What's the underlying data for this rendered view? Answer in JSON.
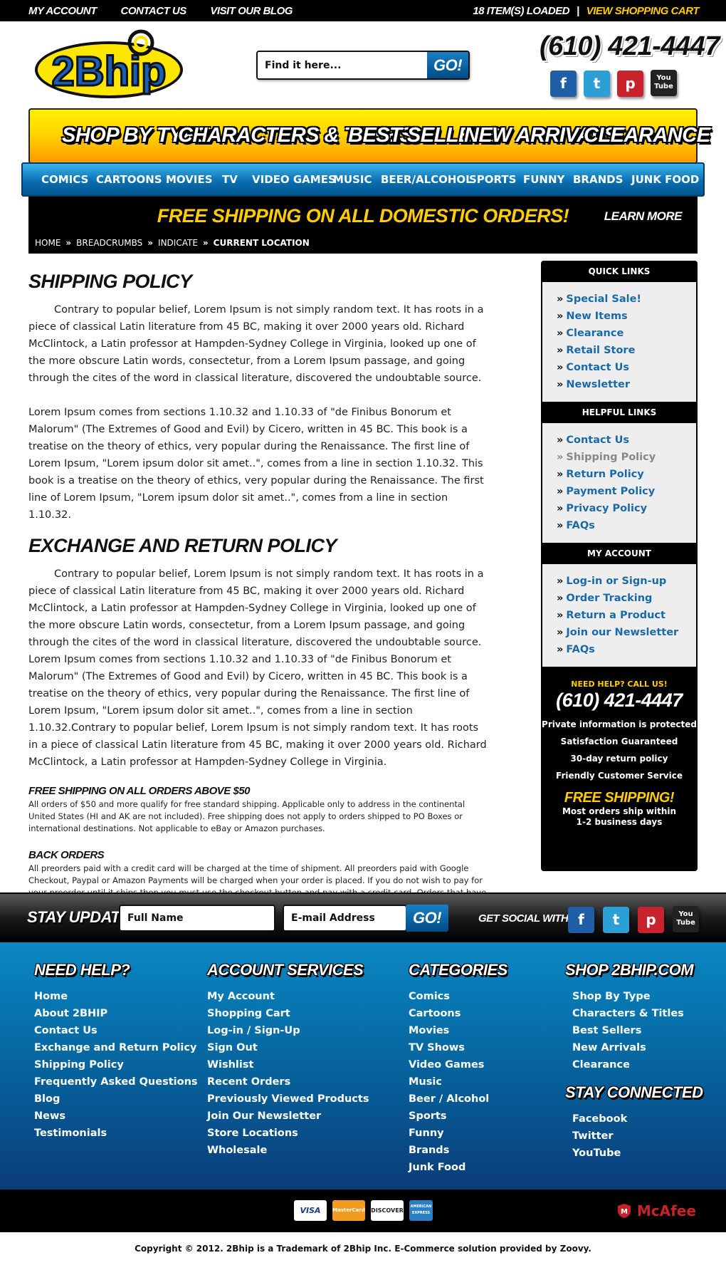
{
  "topbar": {
    "links": [
      "MY ACCOUNT",
      "CONTACT US",
      "VISIT OUR BLOG"
    ],
    "items_loaded": "18 ITEM(S) LOADED",
    "separator": "|",
    "view_cart": "VIEW SHOPPING CART"
  },
  "header": {
    "logo_text": "2Bhip",
    "search_placeholder": "Find it here...",
    "search_button": "GO!",
    "phone": "(610) 421-4447",
    "social": [
      "f",
      "t",
      "p",
      "You Tube"
    ]
  },
  "yellow_nav": [
    "SHOP BY TYPE",
    "CHARACTERS & TITLES",
    "BEST SELLERS",
    "NEW ARRIVALS",
    "CLEARANCE"
  ],
  "blue_nav": [
    "COMICS",
    "CARTOONS",
    "MOVIES",
    "TV",
    "VIDEO GAMES",
    "MUSIC",
    "BEER/ALCOHOL",
    "SPORTS",
    "FUNNY",
    "BRANDS",
    "JUNK FOOD"
  ],
  "banner": {
    "message": "FREE SHIPPING ON ALL DOMESTIC ORDERS!",
    "learn_more": "LEARN MORE"
  },
  "breadcrumb": {
    "items": [
      "HOME",
      "BREADCRUMBS",
      "INDICATE"
    ],
    "current": "CURRENT LOCATION",
    "separator": "»"
  },
  "main": {
    "h1": "SHIPPING POLICY",
    "p1": "Contrary to popular belief, Lorem Ipsum is not simply random text. It has roots in a piece of classical Latin literature from 45 BC, making it over 2000 years old. Richard McClintock, a Latin professor at Hampden-Sydney College in Virginia, looked up one of the more obscure Latin words, consectetur, from a Lorem Ipsum passage, and going through the cites of the word in classical literature, discovered the undoubtable source.",
    "p2": "Lorem Ipsum comes from sections 1.10.32 and 1.10.33 of \"de Finibus Bonorum et Malorum\" (The Extremes of Good and Evil) by Cicero, written in 45 BC. This book is a treatise on the theory of ethics, very popular during the Renaissance. The first line of Lorem Ipsum, \"Lorem ipsum dolor sit amet..\", comes from a line in section 1.10.32. This book is a treatise on the theory of ethics, very popular during the Renaissance. The first line of Lorem Ipsum, \"Lorem ipsum dolor sit amet..\", comes from a line in section 1.10.32.",
    "h2": "EXCHANGE AND RETURN POLICY",
    "p3": "Contrary to popular belief, Lorem Ipsum is not simply random text. It has roots in a piece of classical Latin literature from 45 BC, making it over 2000 years old. Richard McClintock, a Latin professor at Hampden-Sydney College in Virginia, looked up one of the more obscure Latin words, consectetur, from a Lorem Ipsum passage, and going through the cites of the word in classical literature, discovered the undoubtable source. Lorem Ipsum comes from sections 1.10.32 and 1.10.33 of \"de Finibus Bonorum et Malorum\" (The Extremes of Good and Evil) by Cicero, written in 45 BC. This book is a treatise on the theory of ethics, very popular during the Renaissance. The first line of Lorem Ipsum, \"Lorem ipsum dolor sit amet..\", comes from a line in section 1.10.32.Contrary to popular belief, Lorem Ipsum is not simply random text. It has roots in a piece of classical Latin literature from 45 BC, making it over 2000 years old. Richard McClintock, a Latin professor at Hampden-Sydney College in Virginia.",
    "h3": "FREE SHIPPING ON ALL ORDERS ABOVE $50",
    "p4": "All orders of $50 and more qualify for free standard shipping. Applicable only to address in the continental United States (HI and AK are not included). Free shipping does not apply to orders shipped to PO Boxes or international destinations. Not applicable to eBay or Amazon purchases.",
    "h4": "BACK ORDERS",
    "p5": "All preorders paid with a credit card will be charged at the time of shipment. All preorders paid with Google Checkout, Paypal or Amazon Payments will be charged when your order is placed. If you do not wish to pay for your preorder until it ships then you must use the checkout button and pay with a credit card. Orders that have both preorder and instock items we be shipped at the same time in one shipment."
  },
  "sidebar": {
    "quick_title": "QUICK LINKS",
    "quick": [
      "Special Sale!",
      "New Items",
      "Clearance",
      "Retail Store",
      "Contact Us",
      "Newsletter"
    ],
    "helpful_title": "HELPFUL LINKS",
    "helpful": [
      "Contact Us",
      "Shipping Policy",
      "Return Policy",
      "Payment Policy",
      "Privacy Policy",
      "FAQs"
    ],
    "account_title": "MY ACCOUNT",
    "account": [
      "Log-in or Sign-up",
      "Order Tracking",
      "Return a Product",
      "Join our Newsletter",
      "FAQs"
    ],
    "bullet": "»",
    "help": {
      "need": "NEED HELP? CALL US!",
      "phone": "(610) 421-4447",
      "lines": [
        "Private information is protected",
        "Satisfaction Guaranteed",
        "30-day return policy",
        "Friendly Customer Service"
      ],
      "free": "FREE SHIPPING!",
      "ships1": "Most orders ship within",
      "ships2": "1-2 business days"
    }
  },
  "stay": {
    "label": "STAY UPDATED!",
    "name_placeholder": "Full Name",
    "email_placeholder": "E-mail Address",
    "go": "GO!",
    "social_label": "GET SOCIAL WITH US!"
  },
  "footer": {
    "help_title": "NEED HELP?",
    "help": [
      "Home",
      "About 2BHIP",
      "Contact Us",
      "Exchange and Return Policy",
      "Shipping Policy",
      "Frequently Asked Questions",
      "Blog",
      "News",
      "Testimonials"
    ],
    "account_title": "ACCOUNT SERVICES",
    "account": [
      "My Account",
      "Shopping Cart",
      "Log-in / Sign-Up",
      "Sign Out",
      "Wishlist",
      "Recent Orders",
      "Previously Viewed Products",
      "Join Our Newsletter",
      "Store Locations",
      "Wholesale"
    ],
    "categories_title": "CATEGORIES",
    "categories": [
      "Comics",
      "Cartoons",
      "Movies",
      "TV Shows",
      "Video Games",
      "Music",
      "Beer / Alcohol",
      "Sports",
      "Funny",
      "Brands",
      "Junk Food"
    ],
    "shop_title": "SHOP 2BHIP.COM",
    "shop": [
      "Shop By Type",
      "Characters & Titles",
      "Best Sellers",
      "New Arrivals",
      "Clearance"
    ],
    "connected_title": "STAY CONNECTED",
    "connected": [
      "Facebook",
      "Twitter",
      "YouTube"
    ]
  },
  "payment": {
    "cards": [
      "VISA",
      "MasterCard",
      "DISCOVER",
      "AMERICAN EXPRESS"
    ],
    "mcafee": "McAfee"
  },
  "copyright": "Copyright © 2012. 2Bhip is a Trademark of 2Bhip Inc. E-Commerce solution provided by Zoovy.",
  "colors": {
    "accent_yellow": "#ffcc00",
    "link_blue": "#1a6aa8",
    "footer_blue": "#0a88c4"
  }
}
